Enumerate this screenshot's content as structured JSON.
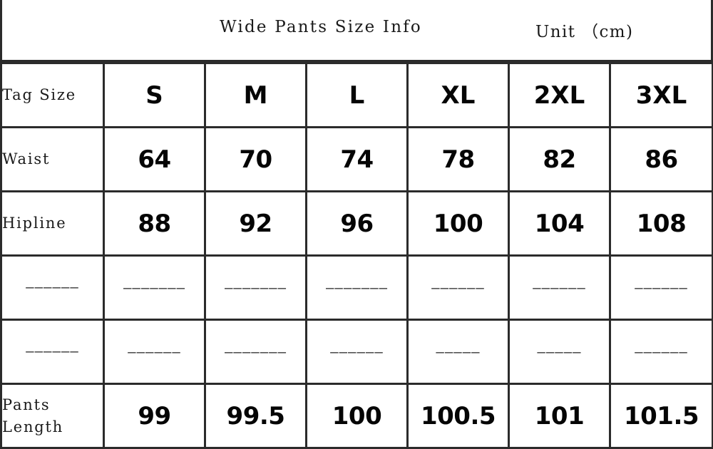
{
  "title": {
    "main": "Wide Pants Size Info",
    "unit": "Unit （cm)"
  },
  "colors": {
    "border": "#2b2b2b",
    "text": "#1a1a1a",
    "value_text": "#050505",
    "background": "#ffffff"
  },
  "table": {
    "columns": [
      "Tag Size",
      "S",
      "M",
      "L",
      "XL",
      "2XL",
      "3XL"
    ],
    "rows": [
      {
        "label": "Tag Size",
        "type": "header",
        "values": [
          "S",
          "M",
          "L",
          "XL",
          "2XL",
          "3XL"
        ]
      },
      {
        "label": "Waist",
        "type": "data",
        "values": [
          "64",
          "70",
          "74",
          "78",
          "82",
          "86"
        ]
      },
      {
        "label": "Hipline",
        "type": "data",
        "values": [
          "88",
          "92",
          "96",
          "100",
          "104",
          "108"
        ]
      },
      {
        "label": "——————",
        "type": "redacted",
        "values": [
          "———————",
          "———————",
          "———————",
          "——————",
          "——————",
          "——————"
        ]
      },
      {
        "label": "——————",
        "type": "redacted",
        "values": [
          "——————",
          "———————",
          "——————",
          "—————",
          "—————",
          "——————"
        ]
      },
      {
        "label": "Pants\nLength",
        "type": "data",
        "values": [
          "99",
          "99.5",
          "100",
          "100.5",
          "101",
          "101.5"
        ]
      }
    ]
  }
}
